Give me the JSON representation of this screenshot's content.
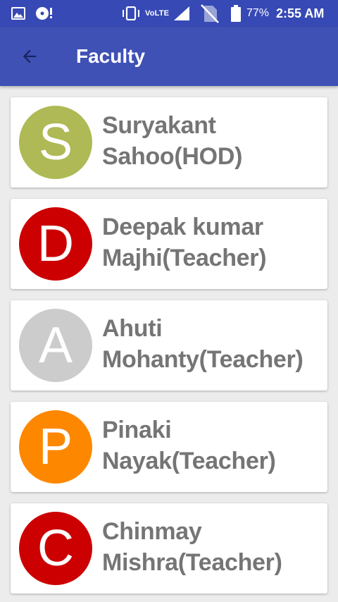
{
  "status_bar": {
    "network_label": "VoLTE",
    "battery_percent": "77%",
    "time": "2:55 AM",
    "icons": [
      "gallery-icon",
      "disc-alert-icon",
      "vibrate-icon",
      "signal-icon",
      "no-sim-icon",
      "battery-icon"
    ]
  },
  "app_bar": {
    "title": "Faculty",
    "back_icon": "arrow-back-icon",
    "background": "#3f51b5"
  },
  "faculty": [
    {
      "initial": "S",
      "name": "Suryakant Sahoo(HOD)",
      "color": "#afb955"
    },
    {
      "initial": "D",
      "name": "Deepak kumar Majhi(Teacher)",
      "color": "#cc0000"
    },
    {
      "initial": "A",
      "name": "Ahuti Mohanty(Teacher)",
      "color": "#cccccc"
    },
    {
      "initial": "P",
      "name": "Pinaki Nayak(Teacher)",
      "color": "#fd8800"
    },
    {
      "initial": "C",
      "name": "Chinmay Mishra(Teacher)",
      "color": "#cc0000"
    }
  ]
}
